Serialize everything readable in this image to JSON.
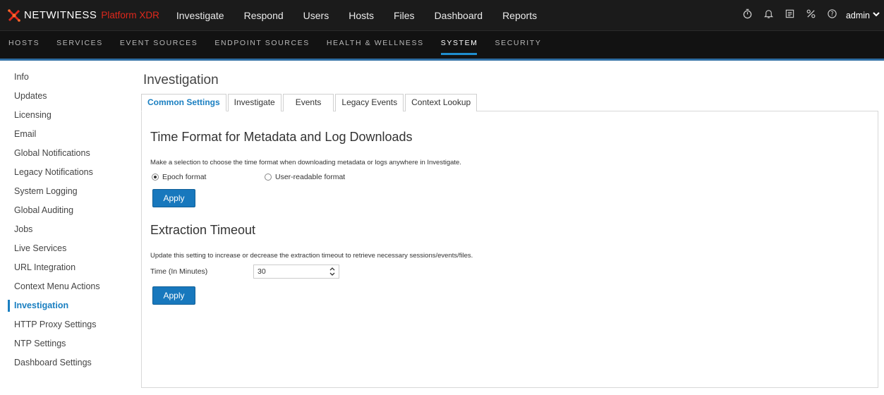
{
  "topbar": {
    "logo_text": "NETWITNESS",
    "logo_sub": "Platform XDR",
    "nav": [
      "Investigate",
      "Respond",
      "Users",
      "Hosts",
      "Files",
      "Dashboard",
      "Reports"
    ],
    "user": "admin"
  },
  "subnav": {
    "items": [
      "HOSTS",
      "SERVICES",
      "EVENT SOURCES",
      "ENDPOINT SOURCES",
      "HEALTH & WELLNESS",
      "SYSTEM",
      "SECURITY"
    ],
    "active": "SYSTEM"
  },
  "sidebar": {
    "items": [
      "Info",
      "Updates",
      "Licensing",
      "Email",
      "Global Notifications",
      "Legacy Notifications",
      "System Logging",
      "Global Auditing",
      "Jobs",
      "Live Services",
      "URL Integration",
      "Context Menu Actions",
      "Investigation",
      "HTTP Proxy Settings",
      "NTP Settings",
      "Dashboard Settings"
    ],
    "active": "Investigation"
  },
  "page": {
    "title": "Investigation",
    "tabs": [
      "Common Settings",
      "Investigate",
      "Events",
      "Legacy Events",
      "Context Lookup"
    ],
    "active_tab": "Common Settings"
  },
  "time_format": {
    "title": "Time Format for Metadata and Log Downloads",
    "help": "Make a selection to choose the time format when downloading metadata or logs anywhere in Investigate.",
    "options": [
      "Epoch format",
      "User-readable format"
    ],
    "selected": "Epoch format",
    "apply_label": "Apply"
  },
  "extraction": {
    "title": "Extraction Timeout",
    "help": "Update this setting to increase or decrease the extraction timeout to retrieve necessary sessions/events/files.",
    "field_label": "Time (In Minutes)",
    "value": "30",
    "apply_label": "Apply"
  },
  "colors": {
    "accent": "#1a7fc1",
    "brand_red": "#e0281c",
    "topbar": "#1b1b1b"
  }
}
